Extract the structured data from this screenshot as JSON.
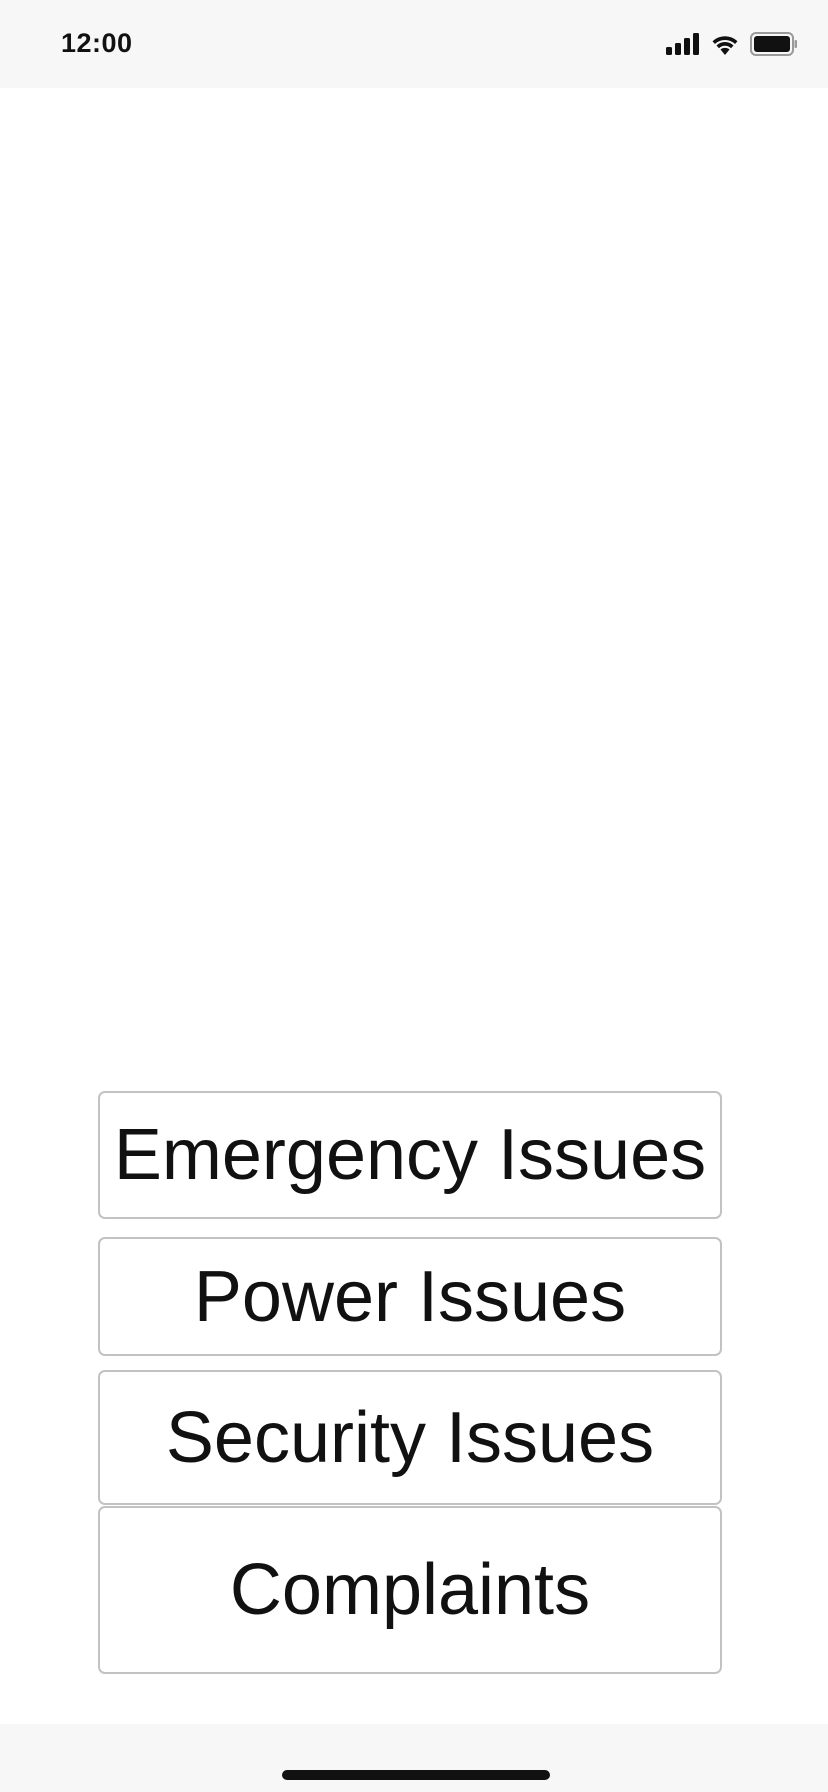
{
  "status_bar": {
    "time": "12:00",
    "icons": [
      "signal-icon",
      "wifi-icon",
      "battery-icon"
    ]
  },
  "menu": {
    "buttons": [
      {
        "label": "Emergency Issues"
      },
      {
        "label": "Power Issues"
      },
      {
        "label": "Security Issues"
      },
      {
        "label": "Complaints"
      }
    ]
  },
  "colors": {
    "bar_background": "#f7f7f7",
    "button_border": "#c2c2c2",
    "text": "#111111"
  }
}
